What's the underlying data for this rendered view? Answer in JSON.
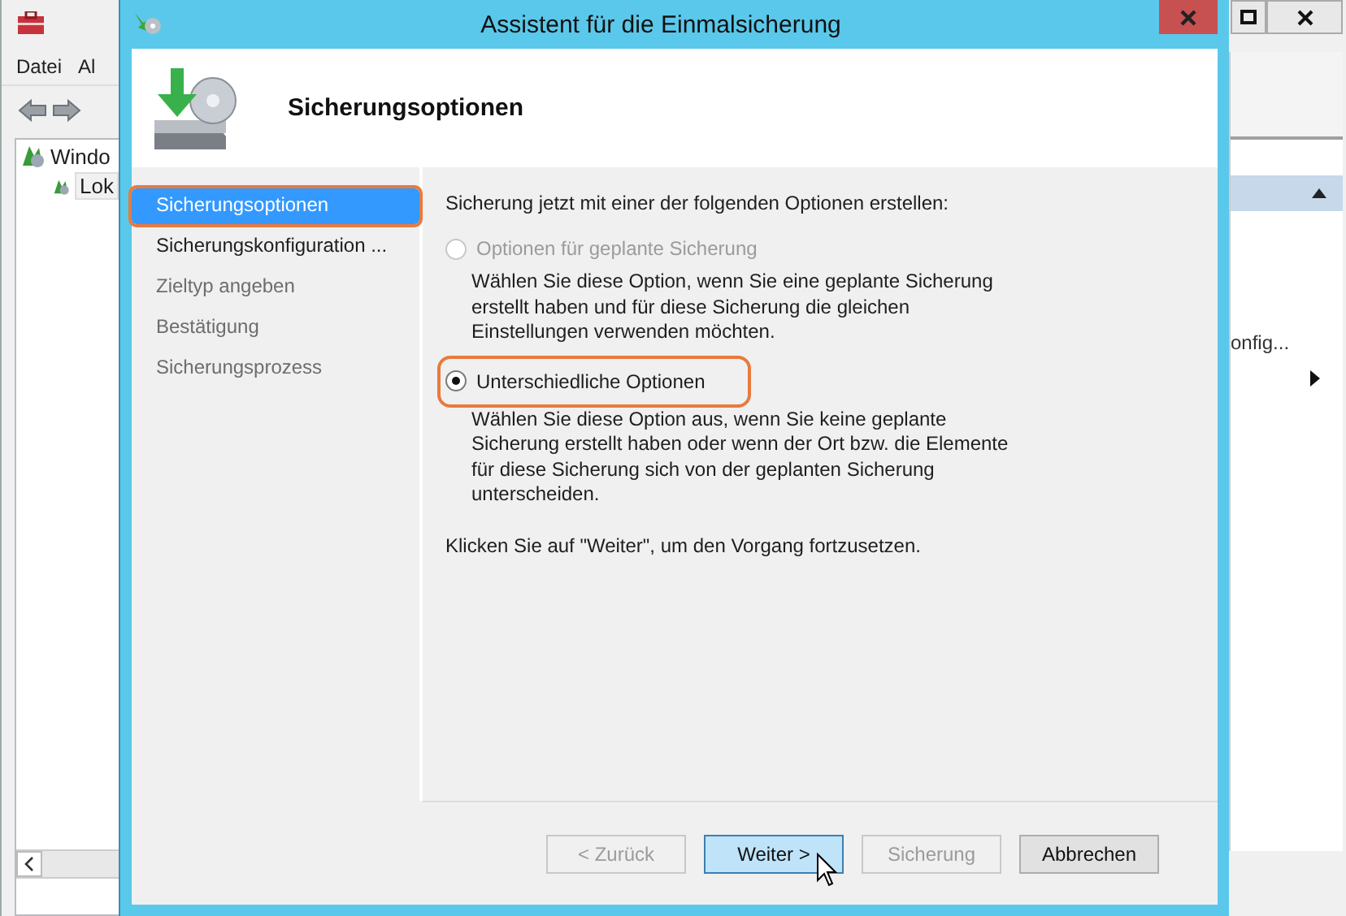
{
  "background_window": {
    "menu": [
      "Datei",
      "Al"
    ],
    "tree": [
      {
        "label": "Windo",
        "children": [
          {
            "label": "Lok"
          }
        ]
      }
    ],
    "right_panel": {
      "item": "onfig..."
    }
  },
  "dialog": {
    "title": "Assistent für die Einmalsicherung",
    "heading": "Sicherungsoptionen",
    "nav": [
      {
        "label": "Sicherungsoptionen",
        "selected": true,
        "disabled": false,
        "highlighted": true
      },
      {
        "label": "Sicherungskonfiguration ...",
        "selected": false,
        "disabled": false,
        "highlighted": false
      },
      {
        "label": "Zieltyp angeben",
        "selected": false,
        "disabled": true,
        "highlighted": false
      },
      {
        "label": "Bestätigung",
        "selected": false,
        "disabled": true,
        "highlighted": false
      },
      {
        "label": "Sicherungsprozess",
        "selected": false,
        "disabled": true,
        "highlighted": false
      }
    ],
    "intro": "Sicherung jetzt mit einer der folgenden Optionen erstellen:",
    "options": [
      {
        "label": "Optionen für geplante Sicherung",
        "selected": false,
        "disabled": true,
        "highlighted": false,
        "description": "Wählen Sie diese Option, wenn Sie eine geplante Sicherung erstellt haben und für diese Sicherung die gleichen Einstellungen verwenden möchten."
      },
      {
        "label": "Unterschiedliche Optionen",
        "selected": true,
        "disabled": false,
        "highlighted": true,
        "description": "Wählen Sie diese Option aus, wenn Sie keine geplante Sicherung erstellt haben oder wenn der Ort bzw. die Elemente für diese Sicherung sich von der geplanten Sicherung unterscheiden."
      }
    ],
    "hint": "Klicken Sie auf \"Weiter\", um den Vorgang fortzusetzen.",
    "buttons": [
      {
        "label": "< Zurück",
        "disabled": true,
        "hovered": false
      },
      {
        "label": "Weiter >",
        "disabled": false,
        "hovered": true
      },
      {
        "label": "Sicherung",
        "disabled": true,
        "hovered": false
      },
      {
        "label": "Abbrechen",
        "disabled": false,
        "hovered": false
      }
    ]
  }
}
